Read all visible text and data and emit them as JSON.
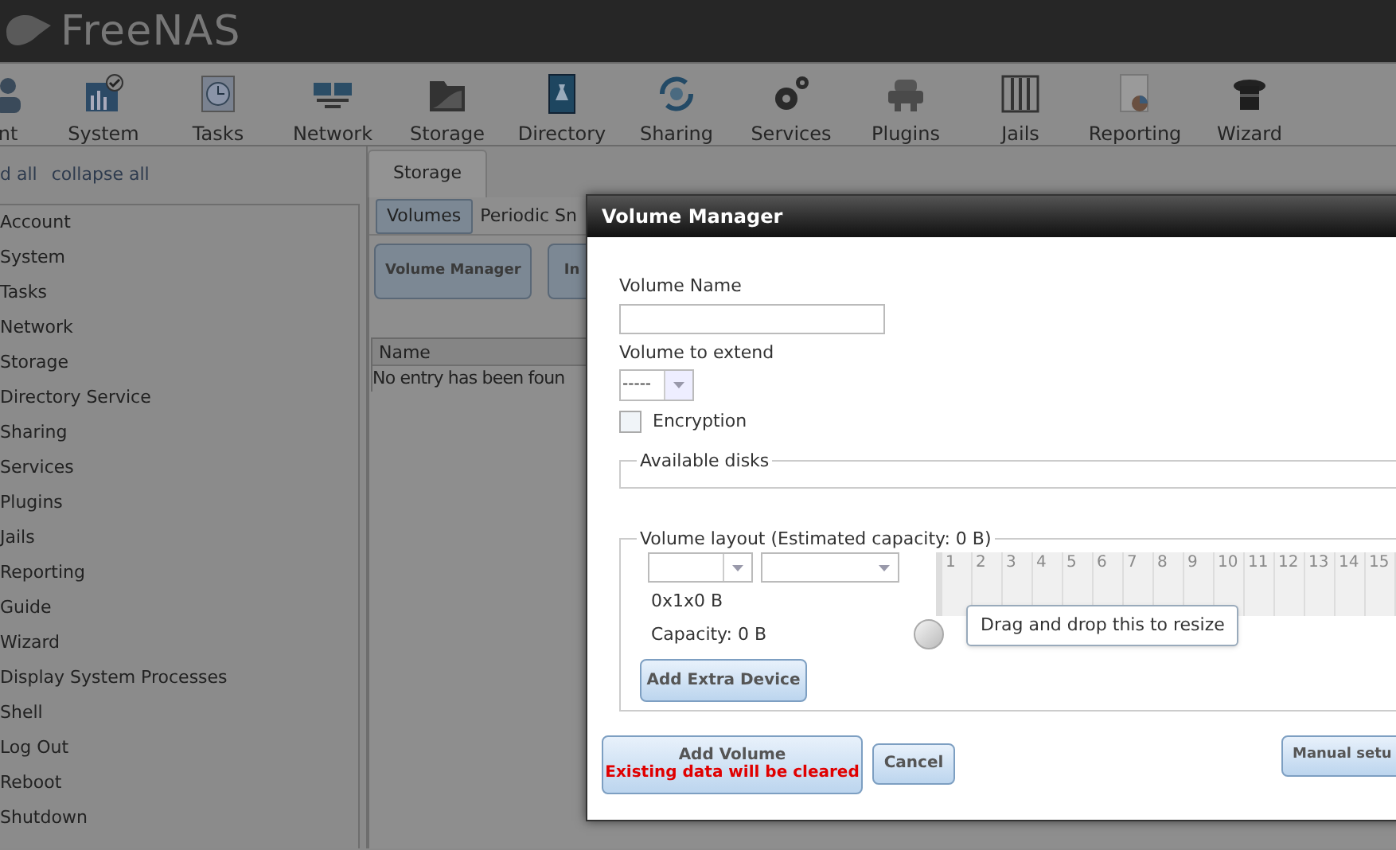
{
  "header": {
    "logo": "FreeNAS"
  },
  "toolbar": [
    {
      "label": "nt",
      "kind": "account"
    },
    {
      "label": "System",
      "kind": "system"
    },
    {
      "label": "Tasks",
      "kind": "tasks"
    },
    {
      "label": "Network",
      "kind": "network"
    },
    {
      "label": "Storage",
      "kind": "storage"
    },
    {
      "label": "Directory",
      "kind": "directory"
    },
    {
      "label": "Sharing",
      "kind": "sharing"
    },
    {
      "label": "Services",
      "kind": "services"
    },
    {
      "label": "Plugins",
      "kind": "plugins"
    },
    {
      "label": "Jails",
      "kind": "jails"
    },
    {
      "label": "Reporting",
      "kind": "reporting"
    },
    {
      "label": "Wizard",
      "kind": "wizard"
    }
  ],
  "tree_controls": [
    "d all",
    "collapse all"
  ],
  "sidebar": {
    "items": [
      "Account",
      "System",
      "Tasks",
      "Network",
      "Storage",
      "Directory Service",
      "Sharing",
      "Services",
      "Plugins",
      "Jails",
      "Reporting",
      "Guide",
      "Wizard",
      "Display System Processes",
      "Shell",
      "Log Out",
      "Reboot",
      "Shutdown"
    ]
  },
  "tabs": [
    {
      "label": "Storage",
      "selected": true
    }
  ],
  "subtabs": [
    {
      "label": "Volumes",
      "selected": true
    },
    {
      "label": "Periodic Sn",
      "selected": false
    }
  ],
  "actions": [
    "Volume Manager",
    "In"
  ],
  "table": {
    "columns": [
      "Name"
    ],
    "empty_text": "No entry has been foun"
  },
  "dialog": {
    "title": "Volume Manager",
    "volume_name": {
      "label": "Volume Name"
    },
    "volume_to_extend": {
      "label": "Volume to extend",
      "value": "-----"
    },
    "encryption": {
      "label": "Encryption",
      "checked": false
    },
    "available_disks": {
      "legend": "Available disks"
    },
    "volume_layout": {
      "legend": "Volume layout (Estimated capacity: 0 B)",
      "size": "0x1x0 B",
      "capacity": "Capacity: 0 B",
      "add_button": "Add Extra Device",
      "disk_columns": [
        "1",
        "2",
        "3",
        "4",
        "5",
        "6",
        "7",
        "8",
        "9",
        "10",
        "11",
        "12",
        "13",
        "14",
        "15"
      ],
      "tooltip": "Drag and drop this to resize"
    },
    "buttons": [
      {
        "kind": "primary",
        "label": "Add Volume",
        "warning": "Existing data will be cleared"
      },
      {
        "kind": "plain",
        "label": "Cancel"
      },
      {
        "kind": "right",
        "label": "Manual setu"
      }
    ]
  }
}
